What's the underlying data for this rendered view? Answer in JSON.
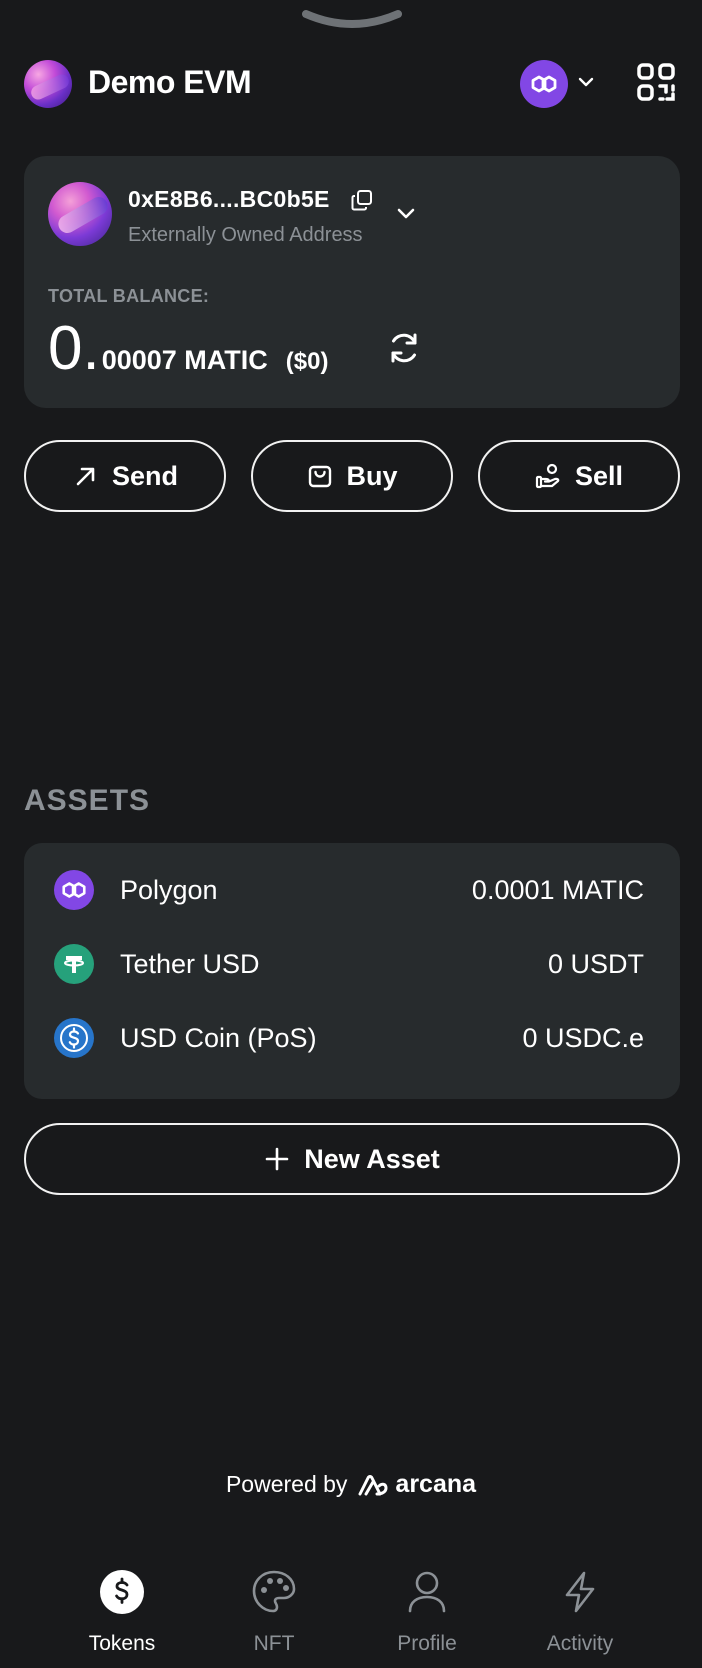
{
  "header": {
    "title": "Demo EVM",
    "chain_icon": "polygon-icon",
    "qr_icon": "qr-scan-icon"
  },
  "account": {
    "address": "0xE8B6....BC0b5E",
    "type": "Externally Owned Address",
    "balance_label": "TOTAL BALANCE:",
    "balance_int": "0",
    "balance_frac": "00007 MATIC",
    "balance_fiat": "($0)"
  },
  "actions": {
    "send": "Send",
    "buy": "Buy",
    "sell": "Sell"
  },
  "assets": {
    "title": "ASSETS",
    "items": [
      {
        "name": "Polygon",
        "amount": "0.0001 MATIC",
        "icon": "polygon-icon",
        "color": "#8247e5"
      },
      {
        "name": "Tether USD",
        "amount": "0 USDT",
        "icon": "tether-icon",
        "color": "#26a17b"
      },
      {
        "name": "USD Coin (PoS)",
        "amount": "0 USDC.e",
        "icon": "usdc-icon",
        "color": "#2775ca"
      }
    ],
    "new_asset": "New Asset"
  },
  "footer": {
    "powered_by": "Powered by",
    "brand": "arcana"
  },
  "nav": {
    "items": [
      {
        "label": "Tokens",
        "icon": "dollar-icon"
      },
      {
        "label": "NFT",
        "icon": "palette-icon"
      },
      {
        "label": "Profile",
        "icon": "user-icon"
      },
      {
        "label": "Activity",
        "icon": "lightning-icon"
      }
    ],
    "active": "Tokens"
  },
  "colors": {
    "background": "#18191b",
    "card": "#272b2d",
    "muted_text": "#8c9196",
    "polygon": "#8247e5"
  }
}
